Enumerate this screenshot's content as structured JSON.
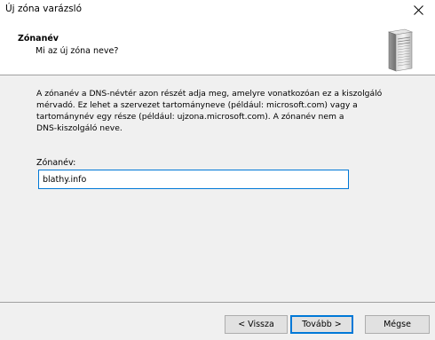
{
  "window": {
    "title": "Új zóna varázsló"
  },
  "header": {
    "title": "Zónanév",
    "subtitle": "Mi az új zóna neve?",
    "icon": "server-icon"
  },
  "content": {
    "description": "A zónanév a DNS-névtér azon részét adja meg, amelyre vonatkozóan ez a kiszolgáló\nmérvadó. Ez lehet a szervezet tartományneve (például: microsoft.com) vagy a\ntartománynév egy része (például: ujzona.microsoft.com). A zónanév nem a\nDNS-kiszolgáló neve.",
    "zone_label": "Zónanév:",
    "zone_value": "blathy.info"
  },
  "buttons": {
    "back": "< Vissza",
    "next": "Tovább >",
    "cancel": "Mégse"
  },
  "colors": {
    "accent": "#0078d7",
    "panel_bg": "#f0f0f0",
    "button_bg": "#e1e1e1"
  }
}
